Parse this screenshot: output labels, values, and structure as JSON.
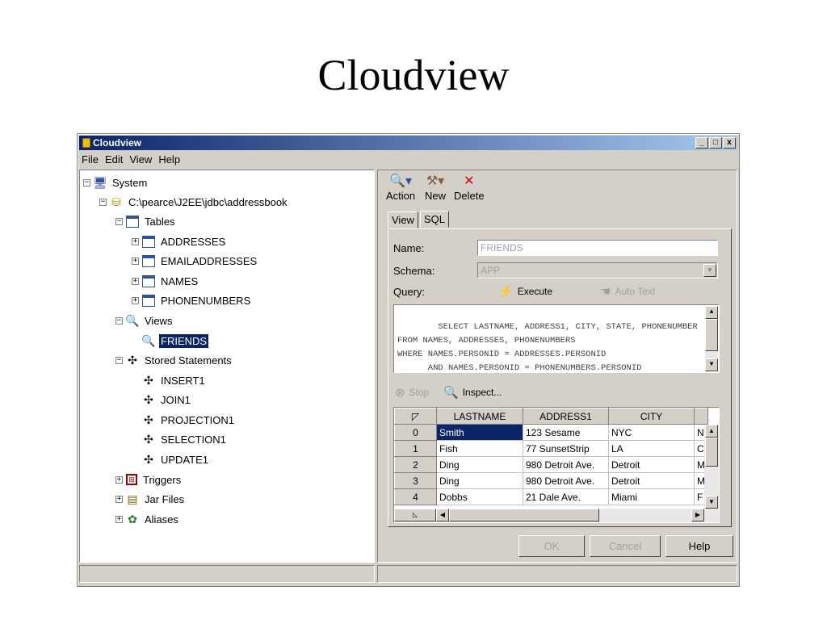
{
  "slide": {
    "title": "Cloudview"
  },
  "window": {
    "title": "Cloudview",
    "minimize": "_",
    "maximize": "□",
    "close": "x"
  },
  "menu": [
    "File",
    "Edit",
    "View",
    "Help"
  ],
  "tree": {
    "system": "System",
    "db": "C:\\pearce\\J2EE\\jdbc\\addressbook",
    "tables": "Tables",
    "table_items": [
      "ADDRESSES",
      "EMAILADDRESSES",
      "NAMES",
      "PHONENUMBERS"
    ],
    "views": "Views",
    "view_items": [
      "FRIENDS"
    ],
    "stored": "Stored Statements",
    "stored_items": [
      "INSERT1",
      "JOIN1",
      "PROJECTION1",
      "SELECTION1",
      "UPDATE1"
    ],
    "triggers": "Triggers",
    "jars": "Jar Files",
    "aliases": "Aliases",
    "expand": "+",
    "collapse": "−"
  },
  "toolbar": {
    "action": "Action",
    "new": "New",
    "delete": "Delete"
  },
  "tabs": [
    "View",
    "SQL"
  ],
  "form": {
    "name_label": "Name:",
    "name_value": "FRIENDS",
    "schema_label": "Schema:",
    "schema_value": "APP",
    "query_label": "Query:",
    "execute": "Execute",
    "auto_text": "Auto Text",
    "query_text": "SELECT LASTNAME, ADDRESS1, CITY, STATE, PHONENUMBER\nFROM NAMES, ADDRESSES, PHONENUMBERS\nWHERE NAMES.PERSONID = ADDRESSES.PERSONID\n      AND NAMES.PERSONID = PHONENUMBERS.PERSONID",
    "stop": "Stop",
    "inspect": "Inspect..."
  },
  "grid": {
    "columns": [
      "LASTNAME",
      "ADDRESS1",
      "CITY"
    ],
    "rows": [
      [
        "0",
        "Smith",
        "123 Sesame",
        "NYC",
        "N"
      ],
      [
        "1",
        "Fish",
        "77 SunsetStrip",
        "LA",
        "C"
      ],
      [
        "2",
        "Ding",
        "980 Detroit Ave.",
        "Detroit",
        "M"
      ],
      [
        "3",
        "Ding",
        "980 Detroit Ave.",
        "Detroit",
        "M"
      ],
      [
        "4",
        "Dobbs",
        "21 Dale Ave.",
        "Miami",
        "F"
      ]
    ]
  },
  "buttons": {
    "ok": "OK",
    "cancel": "Cancel",
    "help": "Help"
  },
  "colors": {
    "selection": "#0a246a",
    "window_bg": "#d4d0c8"
  }
}
